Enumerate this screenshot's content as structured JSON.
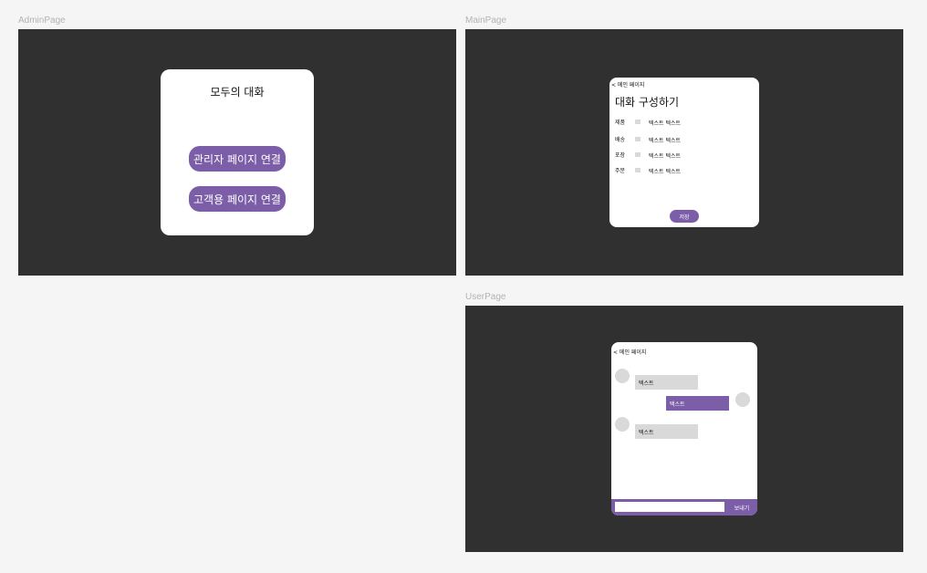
{
  "admin_page": {
    "frame_label": "AdminPage",
    "title": "모두의 대화",
    "admin_link_button": "관리자 페이지 연결",
    "customer_link_button": "고객용 페이지 연결"
  },
  "main_page": {
    "frame_label": "MainPage",
    "back_link": "< 메인 페이지",
    "title": "대화 구성하기",
    "rows": [
      {
        "label": "제품",
        "value": "텍스트 텍스트"
      },
      {
        "label": "배송",
        "value": "텍스트 텍스트"
      },
      {
        "label": "포장",
        "value": "텍스트 텍스트"
      },
      {
        "label": "주문",
        "value": "텍스트 텍스트"
      }
    ],
    "save_button": "저장"
  },
  "user_page": {
    "frame_label": "UserPage",
    "back_link": "< 메인 페이지",
    "messages": [
      {
        "side": "incoming",
        "text": "텍스트"
      },
      {
        "side": "outgoing",
        "text": "텍스트"
      },
      {
        "side": "incoming",
        "text": "텍스트"
      }
    ],
    "input_placeholder": "",
    "send_button": "보내기"
  },
  "colors": {
    "canvas": "#f5f5f5",
    "frame": "#303030",
    "accent": "#7b5ea7",
    "placeholder_gray": "#d9d9d9"
  }
}
